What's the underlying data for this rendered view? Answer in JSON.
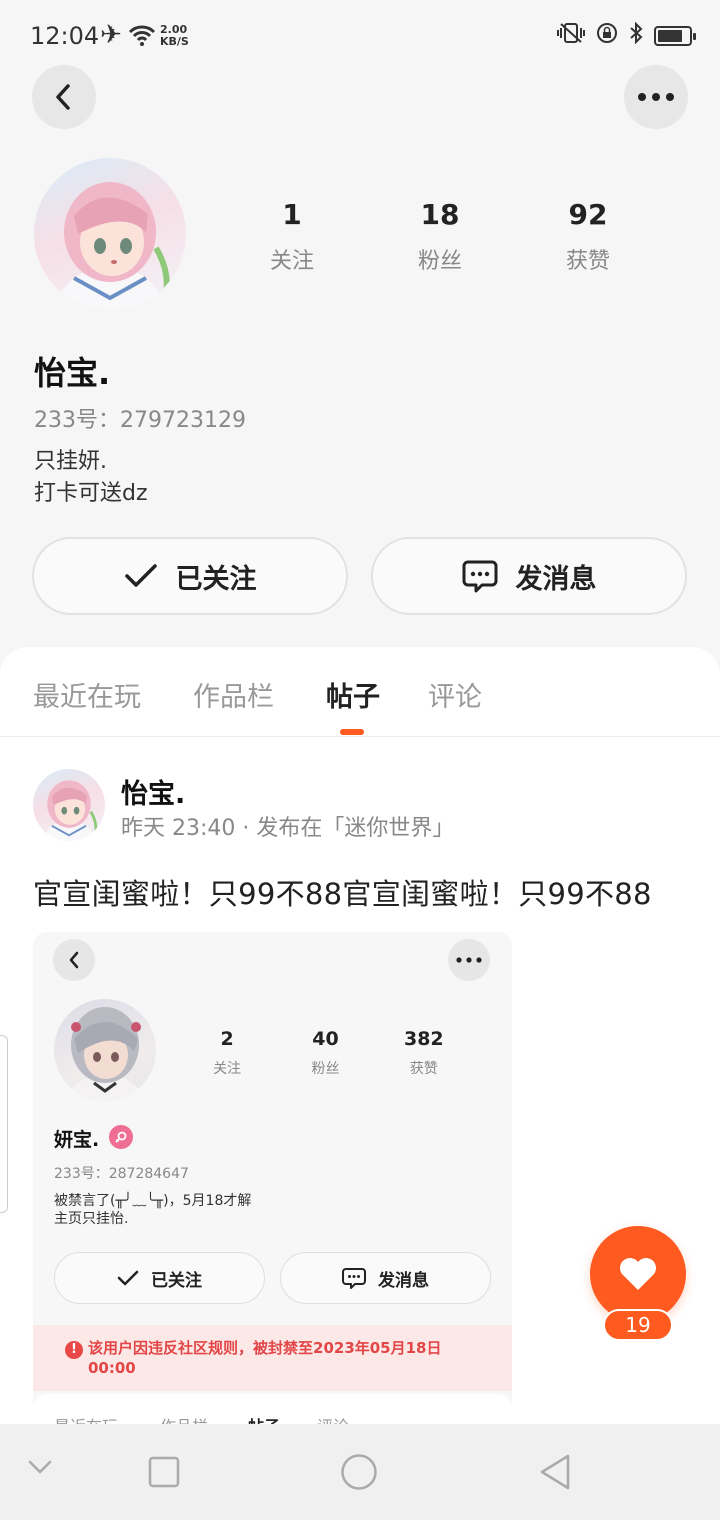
{
  "status_bar": {
    "time": "12:04",
    "net_speed_value": "2.00",
    "net_speed_unit": "KB/S",
    "icons": [
      "airplane-icon",
      "wifi-icon",
      "vibrate-icon",
      "rotation-lock-icon",
      "bluetooth-icon",
      "battery-icon"
    ]
  },
  "profile": {
    "name": "怡宝.",
    "uid": "233号：279723129",
    "bio_line1": "只挂妍.",
    "bio_line2": "打卡可送dz",
    "stats": [
      {
        "value": "1",
        "label": "关注"
      },
      {
        "value": "18",
        "label": "粉丝"
      },
      {
        "value": "92",
        "label": "获赞"
      }
    ],
    "follow_label": "已关注",
    "message_label": "发消息"
  },
  "tabs": [
    {
      "label": "最近在玩",
      "active": false
    },
    {
      "label": "作品栏",
      "active": false
    },
    {
      "label": "帖子",
      "active": true
    },
    {
      "label": "评论",
      "active": false
    }
  ],
  "post": {
    "author": "怡宝.",
    "meta": "昨天 23:40 · 发布在「迷你世界」",
    "text": "官宣闺蜜啦！只99不88官宣闺蜜啦！只99不88",
    "like_count": "19"
  },
  "embedded_screenshot": {
    "name": "妍宝.",
    "uid": "233号：287284647",
    "bio_line1": "被禁言了(╥╯﹏╰╥)，5月18才解",
    "bio_line2": "主页只挂怡.",
    "stats": [
      {
        "value": "2",
        "label": "关注"
      },
      {
        "value": "40",
        "label": "粉丝"
      },
      {
        "value": "382",
        "label": "获赞"
      }
    ],
    "follow_label": "已关注",
    "message_label": "发消息",
    "warning": "该用户因违反社区规则，被封禁至2023年05月18日 00:00",
    "tabs": [
      "最近在玩",
      "作品栏",
      "帖子",
      "评论"
    ]
  },
  "colors": {
    "accent": "#ff5a1f",
    "warning_text": "#e24646",
    "warning_bg": "#fde8e8",
    "female_badge": "#ee6e94"
  }
}
